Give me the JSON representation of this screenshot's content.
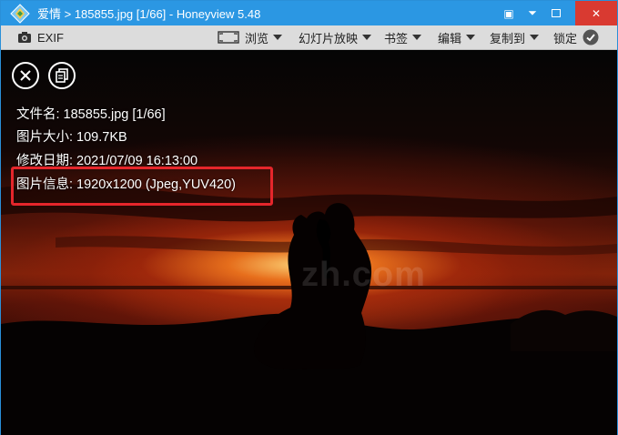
{
  "titlebar": {
    "title": "爱情 > 185855.jpg [1/66] - Honeyview 5.48",
    "controls": [
      "▣",
      "⏷",
      "✕"
    ]
  },
  "toolbar": {
    "exif": "EXIF",
    "browse": "浏览",
    "slideshow": "幻灯片放映",
    "bookmark": "书签",
    "edit": "编辑",
    "copy_to": "复制到",
    "lock": "锁定"
  },
  "info": {
    "filename": "文件名: 185855.jpg [1/66]",
    "filesize": "图片大小: 109.7KB",
    "modified": "修改日期: 2021/07/09 16:13:00",
    "imageinfo": "图片信息: 1920x1200 (Jpeg,YUV420)"
  },
  "watermark": "zh.com",
  "colors": {
    "titlebar": "#2b97e3",
    "toolbar": "#dcdcdc",
    "highlight": "#e5262b",
    "close": "#d93a31"
  }
}
